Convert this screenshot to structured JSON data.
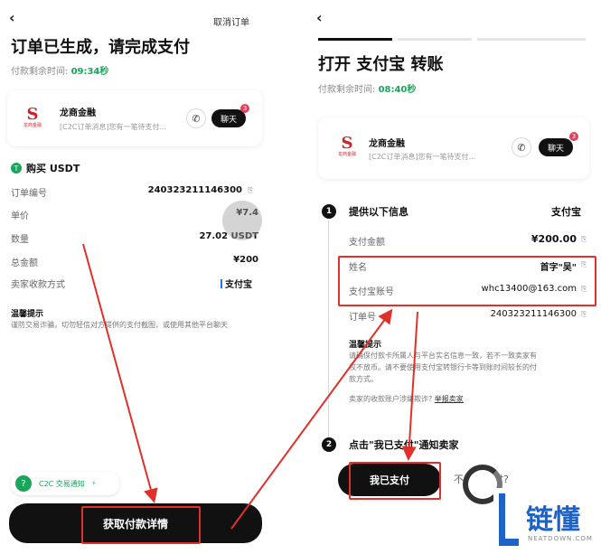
{
  "left": {
    "back_icon": "chevron-left-icon",
    "cancel_label": "取消订单",
    "title": "订单已生成，请完成支付",
    "timer_label": "付款剩余时间:",
    "timer_value": "09:34秒",
    "merchant": {
      "name": "龙商金融",
      "logo_letter": "S",
      "logo_text": "龙商金融",
      "message": "[C2C订单消息]您有一笔待支付...",
      "chat_label": "聊天",
      "badge": "3"
    },
    "buy_label": "购买 USDT",
    "rows": [
      {
        "label": "订单编号",
        "value": "240323211146300"
      },
      {
        "label": "单价",
        "value": "¥7.4"
      },
      {
        "label": "数量",
        "value": "27.02 USDT"
      },
      {
        "label": "总金额",
        "value": "¥200"
      },
      {
        "label": "卖家收款方式",
        "value": "支付宝"
      }
    ],
    "tip_title": "温馨提示",
    "tip_text": "谨防交易诈骗，切勿轻信对方提供的支付截图，或使用其他平台聊天",
    "toast_label": "C2C 交易通知",
    "toast_icon": "question-icon",
    "main_button": "获取付款详情"
  },
  "right": {
    "back_icon": "chevron-left-icon",
    "title": "打开 支付宝 转账",
    "timer_label": "付款剩余时间:",
    "timer_value": "08:40秒",
    "merchant": {
      "name": "龙商金融",
      "logo_letter": "S",
      "logo_text": "龙商金融",
      "message": "[C2C订单消息]您有一笔待支付...",
      "chat_label": "聊天",
      "badge": "3"
    },
    "step1_num": "1",
    "step1_title": "提供以下信息",
    "step1_method": "支付宝",
    "rows": [
      {
        "label": "支付金额",
        "value": "¥200.00"
      },
      {
        "label": "姓名",
        "value": "首字\"吴\""
      },
      {
        "label": "支付宝账号",
        "value": "whc13400@163.com"
      },
      {
        "label": "订单号",
        "value": "240323211146300"
      }
    ],
    "tip_title": "温馨提示",
    "tip_text_1": "请确保付款卡所属人与平台实名信息一致，若不一致卖家有",
    "tip_text_2": "权不放币。请不要使用支付宝转银行卡等到账时间较长的付",
    "tip_text_3": "款方式。",
    "tip_text_4": "卖家的收款账户涉嫌欺诈?",
    "tip_report": "举报卖家",
    "step2_num": "2",
    "step2_title": "点击\"我已支付\"通知卖家",
    "paid_button": "我已支付",
    "not_paid_prefix": "不",
    "not_paid_suffix": "支付?"
  },
  "watermark": {
    "char": "链懂",
    "sub": "NEATDOWN.COM",
    "letter": "L"
  },
  "colors": {
    "accent_green": "#1aa55a",
    "annotation_red": "#e0302a",
    "dark": "#111111"
  }
}
